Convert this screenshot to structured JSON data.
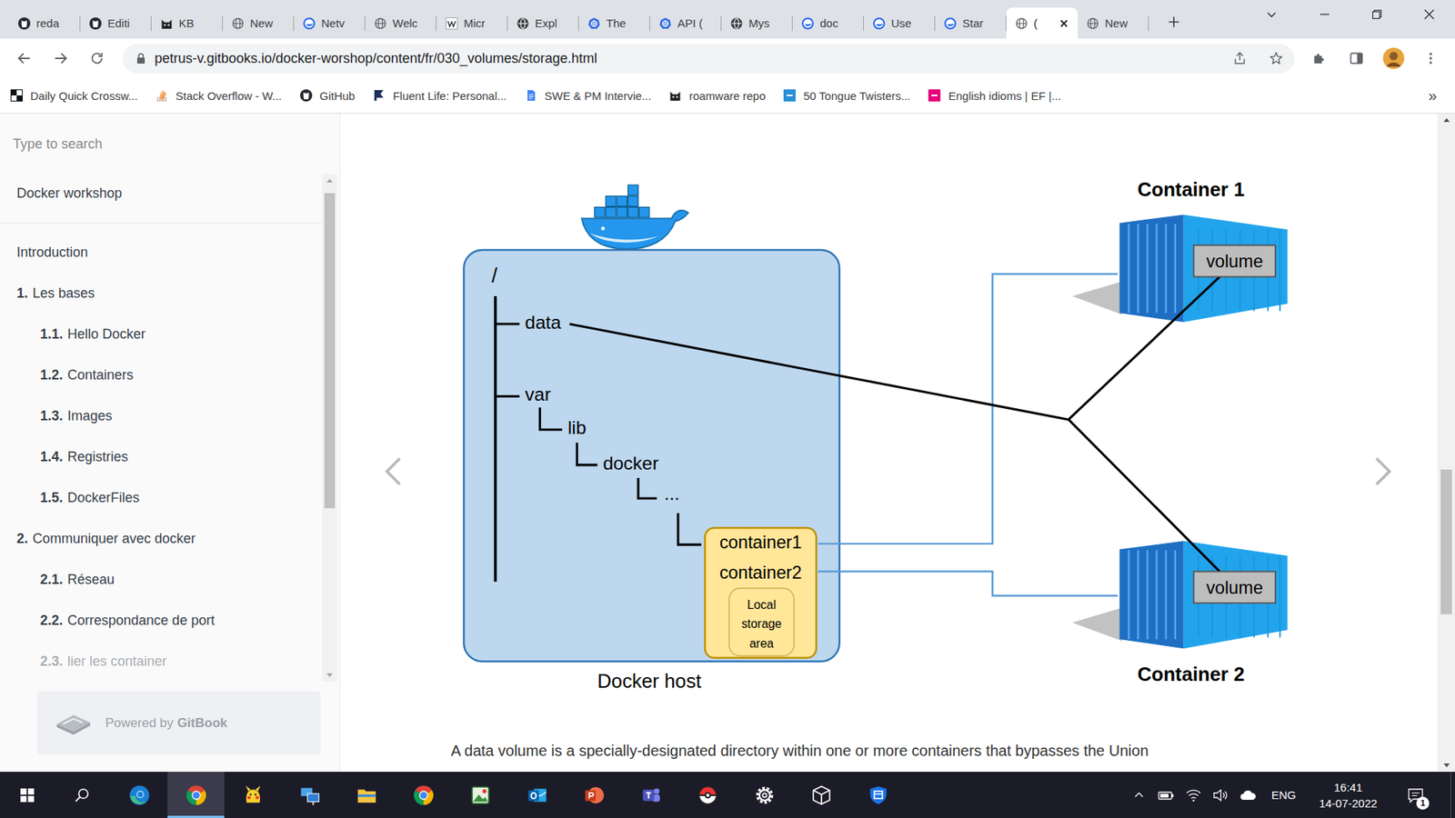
{
  "tabs": [
    {
      "label": "reda",
      "kind": "github",
      "selected": false
    },
    {
      "label": "Editi",
      "kind": "github",
      "selected": false
    },
    {
      "label": "KB",
      "kind": "cat",
      "selected": false
    },
    {
      "label": "New",
      "kind": "globe",
      "selected": false
    },
    {
      "label": "Netv",
      "kind": "docker",
      "selected": false
    },
    {
      "label": "Welc",
      "kind": "globe",
      "selected": false
    },
    {
      "label": "Micr",
      "kind": "wiki",
      "selected": false
    },
    {
      "label": "Expl",
      "kind": "darkglobe",
      "selected": false
    },
    {
      "label": "The",
      "kind": "kubernetes",
      "selected": false
    },
    {
      "label": "API (",
      "kind": "kubernetes",
      "selected": false
    },
    {
      "label": "Mys",
      "kind": "darkglobe",
      "selected": false
    },
    {
      "label": "doc",
      "kind": "docker",
      "selected": false
    },
    {
      "label": "Use",
      "kind": "docker",
      "selected": false
    },
    {
      "label": "Star",
      "kind": "docker",
      "selected": false
    },
    {
      "label": "(",
      "kind": "globe",
      "selected": true
    },
    {
      "label": "New",
      "kind": "globe",
      "selected": false
    }
  ],
  "address": {
    "url": "petrus-v.gitbooks.io/docker-worshop/content/fr/030_volumes/storage.html"
  },
  "bookmarks": {
    "items": [
      {
        "label": "Daily Quick Crossw...",
        "kind": "crossword"
      },
      {
        "label": "Stack Overflow - W...",
        "kind": "stackoverflow"
      },
      {
        "label": "GitHub",
        "kind": "github"
      },
      {
        "label": "Fluent Life: Personal...",
        "kind": "fluent"
      },
      {
        "label": "SWE & PM Intervie...",
        "kind": "docs"
      },
      {
        "label": "roamware repo",
        "kind": "cat"
      },
      {
        "label": "50 Tongue Twisters...",
        "kind": "ev"
      },
      {
        "label": "English idioms | EF |...",
        "kind": "ef"
      }
    ],
    "more": "»"
  },
  "sidebar": {
    "search_placeholder": "Type to search",
    "title": "Docker workshop",
    "items": [
      {
        "number": "",
        "label": "Introduction",
        "kind": "top",
        "faded": false
      },
      {
        "number": "1.",
        "label": "Les bases",
        "kind": "chapter",
        "faded": false
      },
      {
        "number": "1.1.",
        "label": "Hello Docker",
        "kind": "section",
        "faded": false
      },
      {
        "number": "1.2.",
        "label": "Containers",
        "kind": "section",
        "faded": false
      },
      {
        "number": "1.3.",
        "label": "Images",
        "kind": "section",
        "faded": false
      },
      {
        "number": "1.4.",
        "label": "Registries",
        "kind": "section",
        "faded": false
      },
      {
        "number": "1.5.",
        "label": "DockerFiles",
        "kind": "section",
        "faded": false
      },
      {
        "number": "2.",
        "label": "Communiquer avec docker",
        "kind": "chapter",
        "faded": false
      },
      {
        "number": "2.1.",
        "label": "Réseau",
        "kind": "section",
        "faded": false
      },
      {
        "number": "2.2.",
        "label": "Correspondance de port",
        "kind": "section",
        "faded": false
      },
      {
        "number": "2.3.",
        "label": "lier les container",
        "kind": "section",
        "faded": true
      }
    ],
    "powered": {
      "prefix": "Powered by",
      "brand": "GitBook"
    }
  },
  "diagram": {
    "root": "/",
    "tree": [
      "data",
      "var",
      "lib",
      "docker",
      "..."
    ],
    "storage": [
      "container1",
      "container2"
    ],
    "storage_area": [
      "Local",
      "storage",
      "area"
    ],
    "host_label": "Docker host",
    "containers": [
      {
        "title": "Container 1",
        "volume": "volume"
      },
      {
        "title": "Container 2",
        "volume": "volume"
      }
    ]
  },
  "article": {
    "paragraph": "A data volume is a specially-designated directory within one or more containers that bypasses the Union"
  },
  "taskbar": {
    "apps": [
      {
        "kind": "edge",
        "selected": false
      },
      {
        "kind": "chrome",
        "selected": true
      },
      {
        "kind": "pikachu",
        "selected": false
      },
      {
        "kind": "network",
        "selected": false
      },
      {
        "kind": "explorer",
        "selected": false
      },
      {
        "kind": "chrome",
        "selected": false
      },
      {
        "kind": "map",
        "selected": false
      },
      {
        "kind": "outlook",
        "selected": false
      },
      {
        "kind": "powerpoint",
        "selected": false
      },
      {
        "kind": "teams",
        "selected": false
      },
      {
        "kind": "pokeball",
        "selected": false
      },
      {
        "kind": "settings",
        "selected": false
      },
      {
        "kind": "cube",
        "selected": false
      },
      {
        "kind": "shield",
        "selected": false
      }
    ],
    "language": "ENG",
    "time": "16:41",
    "date": "14-07-2022",
    "notifications": "1"
  }
}
